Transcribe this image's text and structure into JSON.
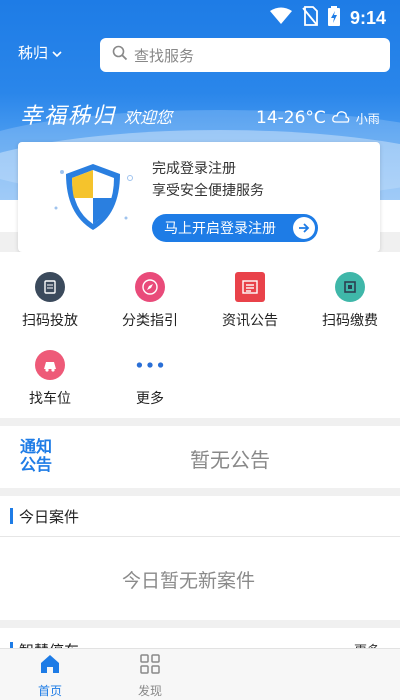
{
  "status_bar": {
    "time": "9:14"
  },
  "header": {
    "city": "秭归",
    "search_placeholder": "查找服务",
    "welcome_main": "幸福秭归",
    "welcome_sub": "欢迎您",
    "temperature": "14-26°C",
    "weather": "小雨"
  },
  "login_card": {
    "line1": "完成登录注册",
    "line2": "享受安全便捷服务",
    "button_label": "马上开启登录注册"
  },
  "services": [
    {
      "label": "扫码投放",
      "icon": "scan-drop-icon",
      "color": "#3b4a5c"
    },
    {
      "label": "分类指引",
      "icon": "compass-icon",
      "color": "#e94b7a"
    },
    {
      "label": "资讯公告",
      "icon": "news-icon",
      "color": "#e9424a"
    },
    {
      "label": "扫码缴费",
      "icon": "scan-pay-icon",
      "color": "#3fb7a9"
    },
    {
      "label": "找车位",
      "icon": "parking-icon",
      "color": "#ee5a78"
    },
    {
      "label": "更多",
      "icon": "more-dots-icon",
      "color": "#2a6fd6"
    }
  ],
  "notice": {
    "tag": "通知公告",
    "empty_text": "暂无公告"
  },
  "today_cases": {
    "title": "今日案件",
    "empty_text": "今日暂无新案件"
  },
  "smart_parking": {
    "title": "智慧停车",
    "more": "更多"
  },
  "bottom_nav": {
    "items": [
      {
        "label": "首页",
        "icon": "home-icon",
        "active": true
      },
      {
        "label": "发现",
        "icon": "discover-grid-icon",
        "active": false
      }
    ]
  },
  "colors": {
    "accent": "#1e7ce6",
    "inactive": "#888888"
  }
}
